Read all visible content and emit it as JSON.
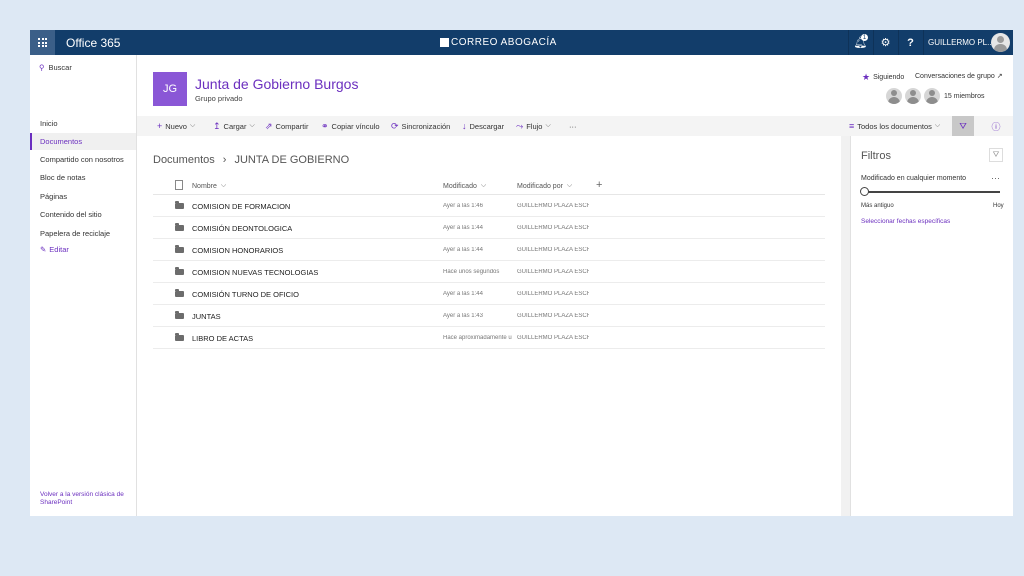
{
  "suitebar": {
    "app_title": "Office 365",
    "brand": "CORREO ABOGACÍA",
    "notification_count": "1",
    "settings_icon": "gear-icon",
    "help_label": "?",
    "user_name": "GUILLERMO PL..."
  },
  "leftnav": {
    "search_label": "Buscar",
    "items": [
      {
        "label": "Inicio"
      },
      {
        "label": "Documentos"
      },
      {
        "label": "Compartido con nosotros"
      },
      {
        "label": "Bloc de notas"
      },
      {
        "label": "Páginas"
      },
      {
        "label": "Contenido del sitio"
      },
      {
        "label": "Papelera de reciclaje"
      }
    ],
    "edit_label": "Editar",
    "classic_link": "Volver a la versión clásica de SharePoint"
  },
  "header": {
    "logo_initials": "JG",
    "site_title": "Junta de Gobierno Burgos",
    "site_subtitle": "Grupo privado",
    "follow_label": "Siguiendo",
    "conversations_label": "Conversaciones de grupo",
    "members_count": "15 miembros"
  },
  "commandbar": {
    "new": "Nuevo",
    "upload": "Cargar",
    "share": "Compartir",
    "copy_link": "Copiar vínculo",
    "sync": "Sincronización",
    "download": "Descargar",
    "flow": "Flujo",
    "more": "···",
    "view": "Todos los documentos"
  },
  "breadcrumb": {
    "root": "Documentos",
    "current": "JUNTA DE GOBIERNO"
  },
  "table": {
    "headers": {
      "name": "Nombre",
      "modified": "Modificado",
      "modified_by": "Modificado por",
      "add": "+"
    },
    "rows": [
      {
        "name": "COMISION DE FORMACION",
        "modified": "Ayer a las 1:46",
        "by": "GUILLERMO PLAZA ESCRI"
      },
      {
        "name": "COMISIÓN DEONTOLOGICA",
        "modified": "Ayer a las 1:44",
        "by": "GUILLERMO PLAZA ESCRI"
      },
      {
        "name": "COMISION HONORARIOS",
        "modified": "Ayer a las 1:44",
        "by": "GUILLERMO PLAZA ESCRI"
      },
      {
        "name": "COMISION NUEVAS TECNOLOGIAS",
        "modified": "Hace unos segundos",
        "by": "GUILLERMO PLAZA ESCRI"
      },
      {
        "name": "COMISIÓN TURNO DE OFICIO",
        "modified": "Ayer a las 1:44",
        "by": "GUILLERMO PLAZA ESCRI"
      },
      {
        "name": "JUNTAS",
        "modified": "Ayer a las 1:43",
        "by": "GUILLERMO PLAZA ESCRI"
      },
      {
        "name": "LIBRO DE ACTAS",
        "modified": "Hace aproximadamente u",
        "by": "GUILLERMO PLAZA ESCRI"
      }
    ]
  },
  "filters": {
    "title": "Filtros",
    "modified_label": "Modificado en cualquier momento",
    "more": "···",
    "slider_value": 0,
    "oldest_label": "Más antiguo",
    "today_label": "Hoy",
    "select_dates": "Seleccionar fechas específicas"
  },
  "colors": {
    "suitebar": "#123d6a",
    "accent": "#6b2fbf",
    "logo": "#8a57d6"
  }
}
